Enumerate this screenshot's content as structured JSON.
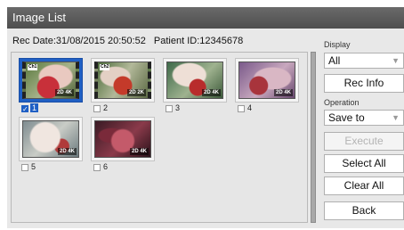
{
  "window": {
    "title": "Image List"
  },
  "header": {
    "rec_date": "Rec Date:31/08/2015 20:50:52",
    "patient_id": "Patient ID:12345678"
  },
  "thumbnails": [
    {
      "label": "1",
      "checked": true,
      "selected": true,
      "channel": "Ch1",
      "badge": "2D 4K"
    },
    {
      "label": "2",
      "checked": false,
      "selected": false,
      "channel": "Ch2",
      "badge": "2D 2K"
    },
    {
      "label": "3",
      "checked": false,
      "selected": false,
      "badge": "2D 4K"
    },
    {
      "label": "4",
      "checked": false,
      "selected": false,
      "badge": "2D 4K"
    },
    {
      "label": "5",
      "checked": false,
      "selected": false,
      "badge": "2D 4K"
    },
    {
      "label": "6",
      "checked": false,
      "selected": false,
      "badge": "2D 4K"
    }
  ],
  "sidebar": {
    "display_label": "Display",
    "display_value": "All",
    "rec_info": "Rec Info",
    "operation_label": "Operation",
    "operation_value": "Save to",
    "execute": "Execute",
    "select_all": "Select All",
    "clear_all": "Clear All",
    "back": "Back"
  },
  "icons": {
    "dropdown": "triangle-down-icon",
    "checkbox": "check-icon"
  },
  "colors": {
    "selection": "#1f5fc4",
    "titlebar": "#5a5a5a"
  }
}
